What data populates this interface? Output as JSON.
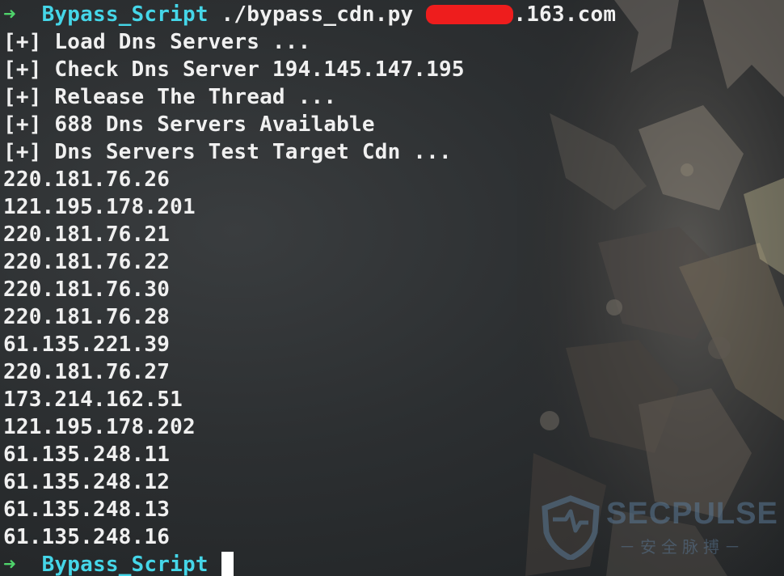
{
  "prompt": {
    "arrow": "➜",
    "directory": "Bypass_Script"
  },
  "command": {
    "text": "./bypass_cdn.py",
    "target_suffix": ".163.com"
  },
  "status_lines": [
    "[+] Load Dns Servers ...",
    "[+] Check Dns Server 194.145.147.195",
    "[+] Release The Thread ...",
    "[+] 688 Dns Servers Available",
    "[+] Dns Servers Test Target Cdn ..."
  ],
  "ip_results": [
    "220.181.76.26",
    "121.195.178.201",
    "220.181.76.21",
    "220.181.76.22",
    "220.181.76.30",
    "220.181.76.28",
    "61.135.221.39",
    "220.181.76.27",
    "173.214.162.51",
    "121.195.178.202",
    "61.135.248.11",
    "61.135.248.12",
    "61.135.248.13",
    "61.135.248.16"
  ],
  "watermark": {
    "brand": "SECPULSE",
    "subtitle": "－安全脉搏－"
  },
  "colors": {
    "prompt_arrow": "#4fd36b",
    "directory": "#45d6e8",
    "text": "#f0f0f0",
    "redaction": "#ee1d1d"
  }
}
